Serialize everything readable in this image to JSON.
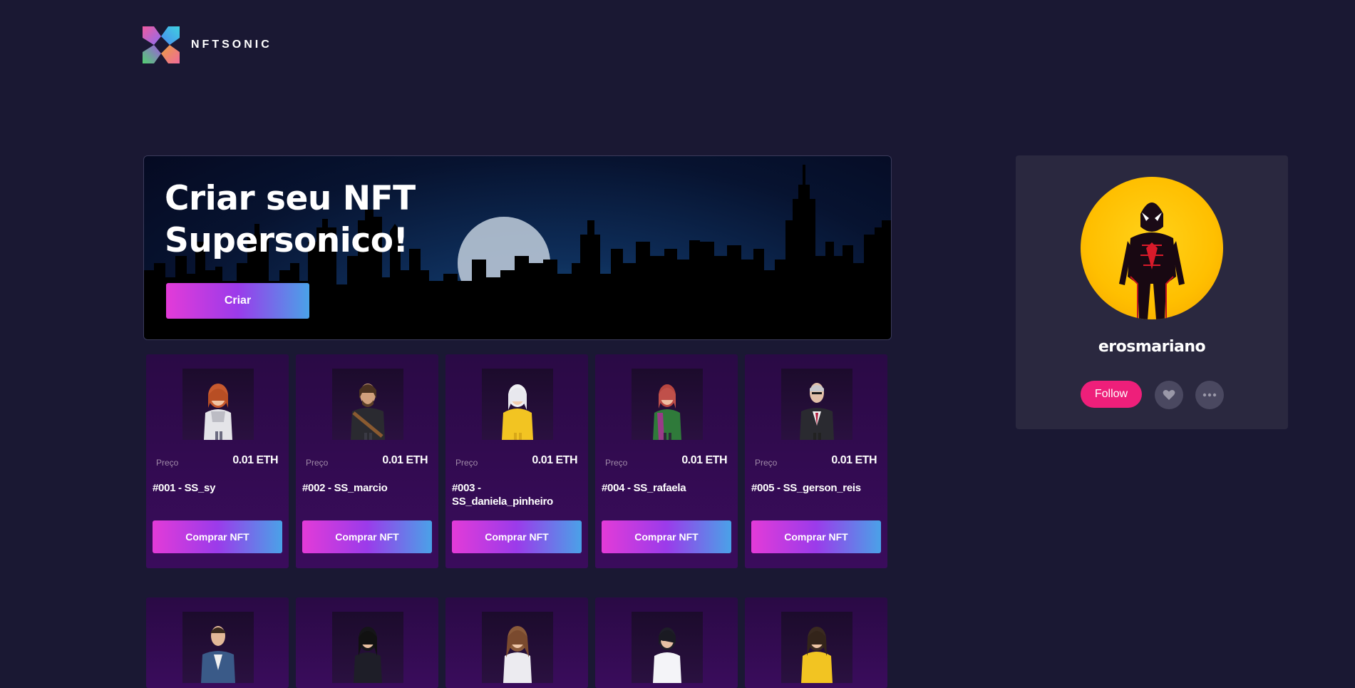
{
  "brand": {
    "name": "NFTSONIC",
    "icon": "nftsonic-logo-icon"
  },
  "hero": {
    "title_line1": "Criar seu NFT",
    "title_line2": "Supersonico!",
    "button_label": "Criar"
  },
  "cards": [
    {
      "price_label": "Preço",
      "price": "0.01 ETH",
      "name": "#001 - SS_sy",
      "button_label": "Comprar NFT"
    },
    {
      "price_label": "Preço",
      "price": "0.01 ETH",
      "name": "#002 - SS_marcio",
      "button_label": "Comprar NFT"
    },
    {
      "price_label": "Preço",
      "price": "0.01 ETH",
      "name": "#003 - SS_daniela_pinheiro",
      "button_label": "Comprar NFT"
    },
    {
      "price_label": "Preço",
      "price": "0.01 ETH",
      "name": "#004 - SS_rafaela",
      "button_label": "Comprar NFT"
    },
    {
      "price_label": "Preço",
      "price": "0.01 ETH",
      "name": "#005 - SS_gerson_reis",
      "button_label": "Comprar NFT"
    }
  ],
  "profile": {
    "username": "erosmariano",
    "follow_label": "Follow",
    "like_icon": "heart-icon",
    "more_icon": "more-dots-icon"
  },
  "colors": {
    "background": "#1a1833",
    "card": "#3a0c5c",
    "panel": "#2a283f",
    "follow": "#ee1f7a",
    "gradient_start": "#e33bd8",
    "gradient_end": "#4aa2e8"
  }
}
